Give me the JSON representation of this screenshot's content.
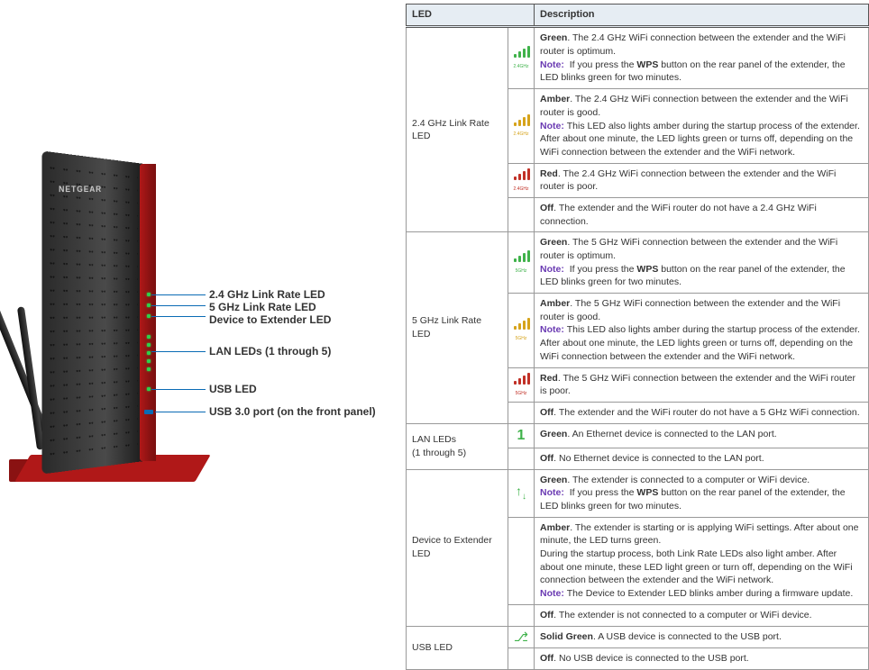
{
  "device": {
    "brand": "NETGEAR",
    "callouts": {
      "link24": "2.4 GHz Link Rate LED",
      "link5": "5 GHz Link Rate LED",
      "d2e": "Device to Extender LED",
      "lan": "LAN LEDs (1 through 5)",
      "usbled": "USB LED",
      "usbport": "USB 3.0 port (on the front panel)"
    }
  },
  "table": {
    "headers": {
      "led": "LED",
      "desc": "Description"
    },
    "bands": {
      "b24": "2.4GHz",
      "b5": "5GHz"
    },
    "rows": {
      "r24": {
        "name": "2.4 GHz Link Rate LED",
        "green_b": "Green",
        "green_t": ". The 2.4 GHz WiFi connection between the extender and the WiFi router is optimum.",
        "green_note": "If you press the ",
        "green_note_b": "WPS",
        "green_note2": " button on the rear panel of the extender, the LED blinks green for two minutes.",
        "amber_b": "Amber",
        "amber_t": ". The 2.4 GHz WiFi connection between the extender and the WiFi router is good.",
        "amber_note": "This LED also lights amber during the startup process of the extender. After about one minute, the LED lights green or turns off, depending on the WiFi connection between the extender and the WiFi network.",
        "red_b": "Red",
        "red_t": ". The 2.4 GHz WiFi connection between the extender and the WiFi router is poor.",
        "off_b": "Off",
        "off_t": ". The extender and the WiFi router do not have a 2.4 GHz WiFi connection."
      },
      "r5": {
        "name": "5 GHz Link Rate LED",
        "green_b": "Green",
        "green_t": ". The 5 GHz WiFi connection between the extender and the WiFi router is optimum.",
        "green_note": "If you press the ",
        "green_note_b": "WPS",
        "green_note2": " button on the rear panel of the extender, the LED blinks green for two minutes.",
        "amber_b": "Amber",
        "amber_t": ". The 5 GHz WiFi connection between the extender and the WiFi router is good.",
        "amber_note": "This LED also lights amber during the startup process of the extender. After about one minute, the LED lights green or turns off, depending on the WiFi connection between the extender and the WiFi network.",
        "red_b": "Red",
        "red_t": ". The 5 GHz WiFi connection between the extender and the WiFi router is poor.",
        "off_b": "Off",
        "off_t": ". The extender and the WiFi router do not have a 5 GHz WiFi connection."
      },
      "lan": {
        "name1": "LAN LEDs",
        "name2": "(1 through 5)",
        "green_b": "Green",
        "green_t": ". An Ethernet device is connected to the LAN port.",
        "off_b": "Off",
        "off_t": ". No Ethernet device is connected to the LAN port."
      },
      "d2e": {
        "name": "Device to Extender LED",
        "green_b": "Green",
        "green_t": ". The extender is connected to a computer or WiFi device.",
        "green_note": "If you press the ",
        "green_note_b": "WPS",
        "green_note2": " button on the rear panel of the extender, the LED blinks green for two minutes.",
        "amber_b": "Amber",
        "amber_t": ". The extender is starting or is applying WiFi settings. After about one minute, the LED turns green.",
        "amber_extra": "During the startup process, both Link Rate LEDs also light amber. After about one minute, these LED light green or turn off, depending on the WiFi connection between the extender and the WiFi network.",
        "amber_note": "The Device to Extender LED blinks amber during a firmware update.",
        "off_b": "Off",
        "off_t": ". The extender is not connected to a computer or WiFi device."
      },
      "usb": {
        "name": "USB LED",
        "green_b": "Solid Green",
        "green_t": ". A USB device is connected to the USB port.",
        "off_b": "Off",
        "off_t": ". No USB device is connected to the USB port."
      }
    },
    "note_label": "Note:"
  }
}
